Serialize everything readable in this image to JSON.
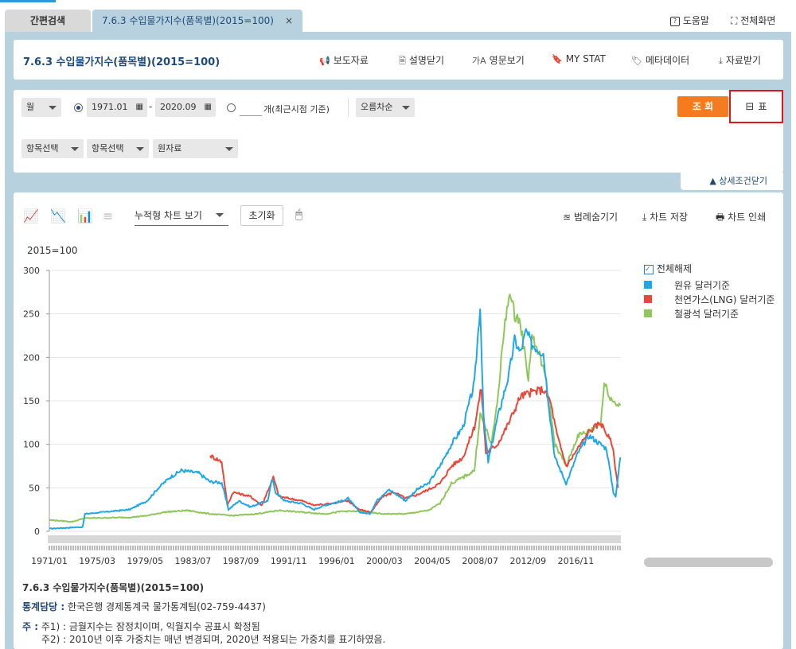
{
  "tabs": [
    {
      "label": "간편검색"
    },
    {
      "label": "7.6.3 수입물가지수(품목별)(2015=100)",
      "close": "×"
    }
  ],
  "top_links": {
    "help": "도움말",
    "fullscreen": "전체화면"
  },
  "header": {
    "title": "7.6.3 수입물가지수(품목별)(2015=100)",
    "buttons": {
      "press": "보도자료",
      "close_desc": "설명닫기",
      "english": "영문보기",
      "mystat": "MY STAT",
      "metadata": "메타데이터",
      "download": "자료받기"
    }
  },
  "filters": {
    "period_type": "월",
    "start": "1971.01",
    "dash": "-",
    "end": "2020.09",
    "recent_suffix": "개(최근시점 기준)",
    "order": "오름차순",
    "search": "조 회",
    "table": "표",
    "item1": "항목선택",
    "item2": "항목선택",
    "item3": "원자료",
    "collapse": "▲ 상세조건닫기"
  },
  "chart_toolbar": {
    "stack": "누적형 차트 보기",
    "reset": "초기화",
    "legend_hide": "범례숨기기",
    "save": "차트 저장",
    "print": "차트 인쇄"
  },
  "legend": {
    "toggle": "전체해제",
    "items": [
      "원유 달러기준",
      "천연가스(LNG) 달러기준",
      "철광석 달러기준"
    ]
  },
  "colors": {
    "oil": "#20a7e8",
    "lng": "#e8473a",
    "iron": "#8fc75a",
    "accent": "#f47b20",
    "navy": "#1e4a7a"
  },
  "chart_data": {
    "type": "line",
    "unit": "2015=100",
    "ylim": [
      0,
      300
    ],
    "yticks": [
      0,
      50,
      100,
      150,
      200,
      250,
      300
    ],
    "xticks": [
      "1971/01",
      "1975/03",
      "1979/05",
      "1983/07",
      "1987/09",
      "1991/11",
      "1996/01",
      "2000/03",
      "2004/05",
      "2008/07",
      "2012/09",
      "2016/11"
    ],
    "series": [
      {
        "name": "원유 달러기준",
        "points": [
          [
            1971.0,
            3
          ],
          [
            1973.9,
            5
          ],
          [
            1974.1,
            20
          ],
          [
            1978.0,
            25
          ],
          [
            1979.5,
            35
          ],
          [
            1980.5,
            50
          ],
          [
            1981.5,
            62
          ],
          [
            1982.5,
            70
          ],
          [
            1984.0,
            67
          ],
          [
            1985.0,
            57
          ],
          [
            1986.0,
            56
          ],
          [
            1986.6,
            25
          ],
          [
            1987.5,
            35
          ],
          [
            1988.5,
            28
          ],
          [
            1989.5,
            33
          ],
          [
            1990.0,
            35
          ],
          [
            1990.4,
            60
          ],
          [
            1990.7,
            45
          ],
          [
            1991.5,
            35
          ],
          [
            1993.0,
            32
          ],
          [
            1994.0,
            25
          ],
          [
            1995.0,
            30
          ],
          [
            1996.5,
            35
          ],
          [
            1997.0,
            38
          ],
          [
            1998.0,
            22
          ],
          [
            1998.9,
            20
          ],
          [
            1999.5,
            35
          ],
          [
            2000.5,
            48
          ],
          [
            2001.5,
            40
          ],
          [
            2002.0,
            35
          ],
          [
            2003.0,
            48
          ],
          [
            2004.0,
            55
          ],
          [
            2005.0,
            75
          ],
          [
            2006.0,
            100
          ],
          [
            2007.0,
            120
          ],
          [
            2008.0,
            170
          ],
          [
            2008.5,
            260
          ],
          [
            2008.8,
            130
          ],
          [
            2009.2,
            80
          ],
          [
            2010.0,
            130
          ],
          [
            2011.0,
            180
          ],
          [
            2011.5,
            220
          ],
          [
            2012.0,
            205
          ],
          [
            2012.5,
            230
          ],
          [
            2013.0,
            215
          ],
          [
            2014.0,
            205
          ],
          [
            2014.6,
            130
          ],
          [
            2015.0,
            85
          ],
          [
            2016.0,
            55
          ],
          [
            2017.0,
            90
          ],
          [
            2018.0,
            110
          ],
          [
            2019.0,
            100
          ],
          [
            2019.5,
            95
          ],
          [
            2020.1,
            45
          ],
          [
            2020.3,
            40
          ],
          [
            2020.7,
            85
          ]
        ]
      },
      {
        "name": "천연가스(LNG) 달러기준",
        "points": [
          [
            1985.0,
            87
          ],
          [
            1986.0,
            80
          ],
          [
            1986.5,
            30
          ],
          [
            1987.0,
            45
          ],
          [
            1988.5,
            40
          ],
          [
            1989.5,
            30
          ],
          [
            1990.5,
            62
          ],
          [
            1991.0,
            40
          ],
          [
            1993.0,
            35
          ],
          [
            1994.0,
            30
          ],
          [
            1995.5,
            32
          ],
          [
            1997.0,
            35
          ],
          [
            1998.0,
            25
          ],
          [
            1999.0,
            22
          ],
          [
            2000.0,
            40
          ],
          [
            2001.0,
            45
          ],
          [
            2002.0,
            38
          ],
          [
            2003.0,
            42
          ],
          [
            2004.0,
            48
          ],
          [
            2005.0,
            55
          ],
          [
            2006.0,
            75
          ],
          [
            2007.0,
            85
          ],
          [
            2008.0,
            120
          ],
          [
            2008.6,
            165
          ],
          [
            2009.0,
            90
          ],
          [
            2010.0,
            100
          ],
          [
            2011.0,
            125
          ],
          [
            2011.5,
            140
          ],
          [
            2012.0,
            155
          ],
          [
            2013.0,
            160
          ],
          [
            2014.0,
            163
          ],
          [
            2014.6,
            150
          ],
          [
            2015.2,
            110
          ],
          [
            2016.0,
            75
          ],
          [
            2017.0,
            95
          ],
          [
            2018.0,
            115
          ],
          [
            2019.0,
            125
          ],
          [
            2020.0,
            100
          ],
          [
            2020.5,
            50
          ]
        ]
      },
      {
        "name": "철광석 달러기준",
        "points": [
          [
            1971.0,
            13
          ],
          [
            1973.0,
            11
          ],
          [
            1974.0,
            15
          ],
          [
            1978.0,
            16
          ],
          [
            1979.5,
            18
          ],
          [
            1981.0,
            22
          ],
          [
            1983.0,
            24
          ],
          [
            1985.0,
            20
          ],
          [
            1987.0,
            18
          ],
          [
            1989.0,
            20
          ],
          [
            1991.0,
            24
          ],
          [
            1993.0,
            22
          ],
          [
            1995.0,
            20
          ],
          [
            1996.5,
            23
          ],
          [
            1998.0,
            23
          ],
          [
            2000.0,
            20
          ],
          [
            2002.0,
            20
          ],
          [
            2004.0,
            24
          ],
          [
            2005.0,
            32
          ],
          [
            2006.0,
            55
          ],
          [
            2007.0,
            62
          ],
          [
            2008.0,
            70
          ],
          [
            2008.5,
            135
          ],
          [
            2009.5,
            100
          ],
          [
            2010.0,
            150
          ],
          [
            2010.5,
            220
          ],
          [
            2011.0,
            275
          ],
          [
            2011.5,
            250
          ],
          [
            2012.0,
            240
          ],
          [
            2012.7,
            175
          ],
          [
            2013.0,
            225
          ],
          [
            2014.0,
            190
          ],
          [
            2014.6,
            140
          ],
          [
            2015.0,
            100
          ],
          [
            2016.0,
            75
          ],
          [
            2017.0,
            110
          ],
          [
            2018.0,
            115
          ],
          [
            2019.0,
            125
          ],
          [
            2019.3,
            170
          ],
          [
            2020.0,
            150
          ],
          [
            2020.7,
            145
          ]
        ]
      }
    ]
  },
  "footer": {
    "title": "7.6.3 수입물가지수(품목별)(2015=100)",
    "contact_label": "통계담당 :",
    "contact": "한국은행 경제통계국 물가통계팀(02-759-4437)",
    "note_label": "주 :",
    "note1": "주1) : 금월지수는 잠정치이며, 익월지수 공표시 확정됨",
    "note2": "주2) : 2010년 이후 가중치는 매년 변경되며, 2020년 적용되는 가중치를 표기하였음."
  }
}
